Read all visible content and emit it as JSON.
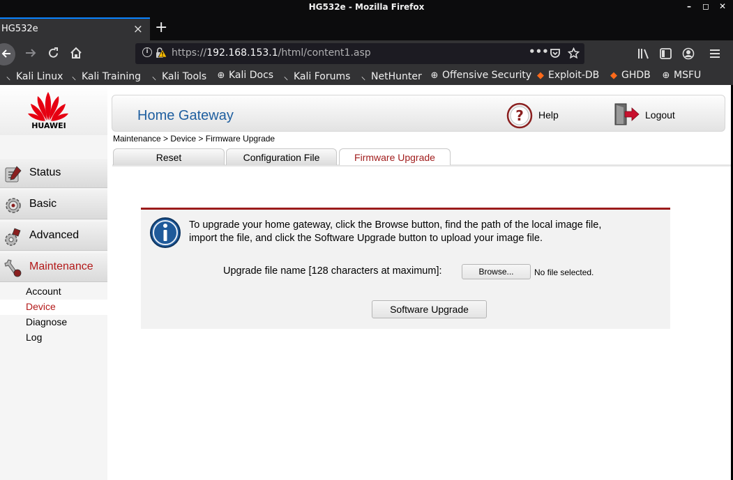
{
  "window": {
    "title": "HG532e - Mozilla Firefox",
    "controls": [
      "–",
      "◻",
      "✕"
    ]
  },
  "tab": {
    "title": "HG532e",
    "close": "×",
    "new_tab": "+"
  },
  "urlbar": {
    "scheme": "https://",
    "host": "192.168.153.1",
    "path": "/html/content1.asp"
  },
  "bookmarks": [
    {
      "label": "Kali Linux",
      "icon": "kali-dragon-icon"
    },
    {
      "label": "Kali Training",
      "icon": "kali-dragon-icon"
    },
    {
      "label": "Kali Tools",
      "icon": "kali-dragon-icon"
    },
    {
      "label": "Kali Docs",
      "icon": "globe-icon"
    },
    {
      "label": "Kali Forums",
      "icon": "kali-dragon-icon"
    },
    {
      "label": "NetHunter",
      "icon": "kali-dragon-icon"
    },
    {
      "label": "Offensive Security",
      "icon": "globe-icon"
    },
    {
      "label": "Exploit-DB",
      "icon": "exploit-db-icon"
    },
    {
      "label": "GHDB",
      "icon": "exploit-db-icon"
    },
    {
      "label": "MSFU",
      "icon": "globe-icon"
    }
  ],
  "brand": {
    "logo_text": "HUAWEI",
    "logo_color": "#e60012"
  },
  "header": {
    "title": "Home Gateway",
    "help": "Help",
    "logout": "Logout"
  },
  "sidebar": {
    "items": [
      {
        "label": "Status",
        "icon": "status-icon"
      },
      {
        "label": "Basic",
        "icon": "basic-gear-icon"
      },
      {
        "label": "Advanced",
        "icon": "advanced-icon"
      },
      {
        "label": "Maintenance",
        "icon": "maintenance-icon",
        "active": true
      }
    ],
    "subitems": [
      {
        "label": "Account"
      },
      {
        "label": "Device",
        "active": true
      },
      {
        "label": "Diagnose"
      },
      {
        "label": "Log"
      }
    ]
  },
  "breadcrumb": "Maintenance > Device > Firmware Upgrade",
  "tabs": [
    {
      "label": "Reset"
    },
    {
      "label": "Configuration File"
    },
    {
      "label": "Firmware Upgrade",
      "active": true
    }
  ],
  "upgrade": {
    "info_line1": "To upgrade your home gateway, click the Browse button, find the path of the local image file,",
    "info_line2": "import the file, and click the Software Upgrade button to upload your image file.",
    "file_label": "Upgrade file name [128 characters at maximum]:",
    "browse_button": "Browse...",
    "no_file": "No file selected.",
    "upgrade_button": "Software Upgrade"
  },
  "colors": {
    "accent_red": "#a11d1d",
    "title_blue": "#1f5fa0",
    "firefox_blue": "#0a84ff"
  }
}
